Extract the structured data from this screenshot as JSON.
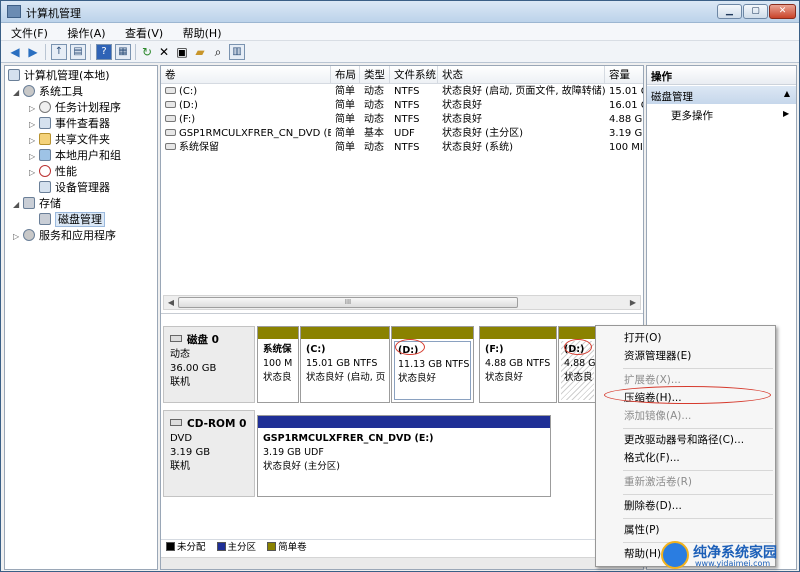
{
  "window": {
    "title": "计算机管理"
  },
  "menubar": [
    "文件(F)",
    "操作(A)",
    "查看(V)",
    "帮助(H)"
  ],
  "toolbar_icons": [
    "back-arrow-icon",
    "forward-arrow-icon",
    "up-folder-icon",
    "console-tree-icon",
    "help-icon",
    "properties-icon",
    "refresh-icon",
    "delete-icon",
    "properties-sheet-icon",
    "open-folder-icon",
    "search-icon",
    "disk-view-icon"
  ],
  "tree": {
    "root": "计算机管理(本地)",
    "system_tools": "系统工具",
    "task_scheduler": "任务计划程序",
    "event_viewer": "事件查看器",
    "shared_folders": "共享文件夹",
    "local_users": "本地用户和组",
    "performance": "性能",
    "device_manager": "设备管理器",
    "storage": "存储",
    "disk_management": "磁盘管理",
    "services": "服务和应用程序"
  },
  "volume_list": {
    "headers": [
      "卷",
      "布局",
      "类型",
      "文件系统",
      "状态",
      "容量"
    ],
    "rows": [
      [
        "(C:)",
        "简单",
        "动态",
        "NTFS",
        "状态良好 (启动, 页面文件, 故障转储)",
        "15.01 C"
      ],
      [
        "(D:)",
        "简单",
        "动态",
        "NTFS",
        "状态良好",
        "16.01 C"
      ],
      [
        "(F:)",
        "简单",
        "动态",
        "NTFS",
        "状态良好",
        "4.88 GB"
      ],
      [
        "GSP1RMCULXFRER_CN_DVD (E:)",
        "简单",
        "基本",
        "UDF",
        "状态良好 (主分区)",
        "3.19 GB"
      ],
      [
        "系统保留",
        "简单",
        "动态",
        "NTFS",
        "状态良好 (系统)",
        "100 MI"
      ]
    ],
    "scroll_grip": "III"
  },
  "disk0": {
    "name": "磁盘 0",
    "type": "动态",
    "size": "36.00 GB",
    "status": "联机",
    "partitions": [
      {
        "name": "系统保",
        "size": "100 M",
        "status": "状态良"
      },
      {
        "name": "(C:)",
        "size": "15.01 GB NTFS",
        "status": "状态良好 (启动, 页"
      },
      {
        "name": "(D:)",
        "size": "11.13 GB NTFS",
        "status": "状态良好"
      },
      {
        "name": "(F:)",
        "size": "4.88 GB NTFS",
        "status": "状态良好"
      },
      {
        "name": "(D:)",
        "size": "4.88 G",
        "status": "状态良"
      }
    ]
  },
  "cdrom0": {
    "name": "CD-ROM 0",
    "type": "DVD",
    "size": "3.19 GB",
    "status": "联机",
    "partition": {
      "name": "GSP1RMCULXFRER_CN_DVD  (E:)",
      "size": "3.19 GB UDF",
      "status": "状态良好 (主分区)"
    }
  },
  "legend": [
    {
      "label": "未分配",
      "color": "#000000"
    },
    {
      "label": "主分区",
      "color": "#1f2f96"
    },
    {
      "label": "简单卷",
      "color": "#8a8200"
    }
  ],
  "actions": {
    "header": "操作",
    "section": "磁盘管理",
    "more": "更多操作"
  },
  "context_menu": [
    {
      "label": "打开(O)",
      "enabled": true
    },
    {
      "label": "资源管理器(E)",
      "enabled": true
    },
    {
      "label": "扩展卷(X)...",
      "enabled": false
    },
    {
      "label": "压缩卷(H)...",
      "enabled": true
    },
    {
      "label": "添加镜像(A)...",
      "enabled": false
    },
    {
      "label": "更改驱动器号和路径(C)...",
      "enabled": true
    },
    {
      "label": "格式化(F)...",
      "enabled": true
    },
    {
      "label": "重新激活卷(R)",
      "enabled": false
    },
    {
      "label": "删除卷(D)...",
      "enabled": true
    },
    {
      "label": "属性(P)",
      "enabled": true
    },
    {
      "label": "帮助(H)",
      "enabled": true
    }
  ],
  "watermark": {
    "text": "纯净系统家园",
    "url": "www.yidaimei.com"
  },
  "colors": {
    "simple_volume": "#8a8200",
    "primary_partition": "#1f2f96",
    "annotation": "#d63b2e"
  }
}
